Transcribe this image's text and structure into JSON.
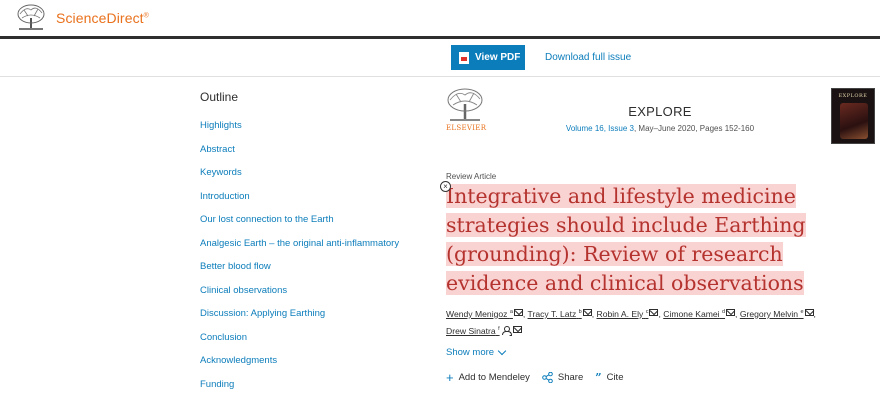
{
  "header": {
    "brand": "ScienceDirect",
    "brand_mark": "®"
  },
  "actions": {
    "view_pdf": "View PDF",
    "download_issue": "Download full issue"
  },
  "outline": {
    "title": "Outline",
    "items": [
      "Highlights",
      "Abstract",
      "Keywords",
      "Introduction",
      "Our lost connection to the Earth",
      "Analgesic Earth – the original anti-inflammatory",
      "Better blood flow",
      "Clinical observations",
      "Discussion: Applying Earthing",
      "Conclusion",
      "Acknowledgments",
      "Funding"
    ]
  },
  "journal": {
    "publisher": "ELSEVIER",
    "name": "EXPLORE",
    "volume_issue": "Volume 16, Issue 3",
    "date_pages": ", May–June 2020, Pages 152-160",
    "cover_label": "EXPLORE"
  },
  "article": {
    "type": "Review Article",
    "title": "Integrative and lifestyle medicine strategies should include Earthing (grounding): Review of research evidence and clinical observations",
    "authors": [
      {
        "name": "Wendy Menigoz",
        "sup": "a"
      },
      {
        "name": "Tracy T. Latz",
        "sup": "b"
      },
      {
        "name": "Robin A. Ely",
        "sup": "c"
      },
      {
        "name": "Cimone Kamei",
        "sup": "d"
      },
      {
        "name": "Gregory Melvin",
        "sup": "e"
      },
      {
        "name": "Drew Sinatra",
        "sup": "f"
      }
    ],
    "show_more": "Show more",
    "tools": {
      "mendeley": "Add to Mendeley",
      "share": "Share",
      "cite": "Cite"
    }
  },
  "colors": {
    "brand_orange": "#e9711c",
    "link_blue": "#0c7dbb",
    "title_red": "#b5332e",
    "highlight_pink": "#f9d2d2"
  }
}
